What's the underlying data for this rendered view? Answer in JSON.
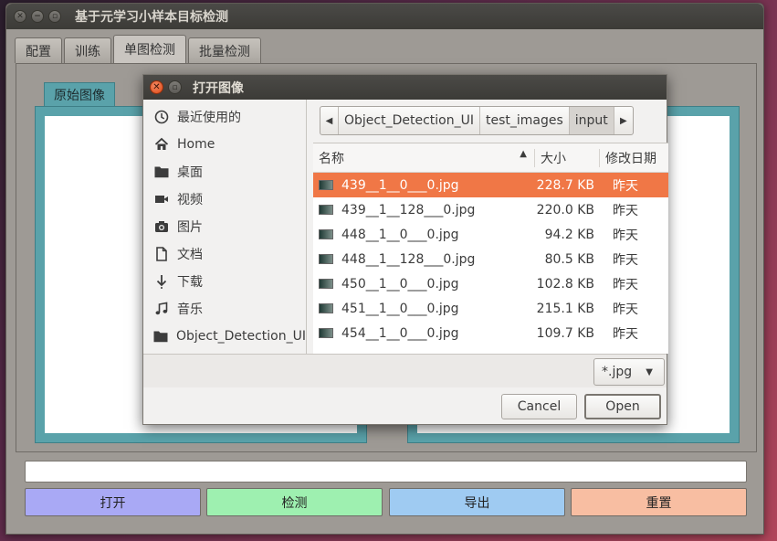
{
  "window": {
    "title": "基于元学习小样本目标检测",
    "tabs": [
      "配置",
      "训练",
      "单图检测",
      "批量检测"
    ],
    "active_tab": "单图检测",
    "image_tab": "原始图像",
    "path_value": "",
    "buttons": {
      "open": {
        "label": "打开",
        "color": "#a9a9f5"
      },
      "detect": {
        "label": "检测",
        "color": "#9ef0b0"
      },
      "export": {
        "label": "导出",
        "color": "#9fcbf2"
      },
      "reset": {
        "label": "重置",
        "color": "#f8bea2"
      }
    },
    "panel_color": "#5aa2aa"
  },
  "dialog": {
    "title": "打开图像",
    "places": [
      {
        "label": "最近使用的",
        "icon": "clock-icon"
      },
      {
        "label": "Home",
        "icon": "home-icon"
      },
      {
        "label": "桌面",
        "icon": "folder-icon"
      },
      {
        "label": "视频",
        "icon": "video-icon"
      },
      {
        "label": "图片",
        "icon": "camera-icon"
      },
      {
        "label": "文档",
        "icon": "document-icon"
      },
      {
        "label": "下载",
        "icon": "download-icon"
      },
      {
        "label": "音乐",
        "icon": "music-icon"
      },
      {
        "label": "Object_Detection_UI",
        "icon": "folder-icon"
      }
    ],
    "breadcrumb": [
      "Object_Detection_UI",
      "test_images",
      "input"
    ],
    "columns": {
      "name": "名称",
      "size": "大小",
      "modified": "修改日期"
    },
    "files": [
      {
        "name": "439__1__0___0.jpg",
        "size": "228.7 KB",
        "modified": "昨天",
        "selected": true
      },
      {
        "name": "439__1__128___0.jpg",
        "size": "220.0 KB",
        "modified": "昨天"
      },
      {
        "name": "448__1__0___0.jpg",
        "size": "94.2 KB",
        "modified": "昨天"
      },
      {
        "name": "448__1__128___0.jpg",
        "size": "80.5 KB",
        "modified": "昨天"
      },
      {
        "name": "450__1__0___0.jpg",
        "size": "102.8 KB",
        "modified": "昨天"
      },
      {
        "name": "451__1__0___0.jpg",
        "size": "215.1 KB",
        "modified": "昨天"
      },
      {
        "name": "454__1__0___0.jpg",
        "size": "109.7 KB",
        "modified": "昨天"
      }
    ],
    "filter": "*.jpg",
    "cancel_label": "Cancel",
    "open_label": "Open",
    "accent_color": "#f07746"
  }
}
